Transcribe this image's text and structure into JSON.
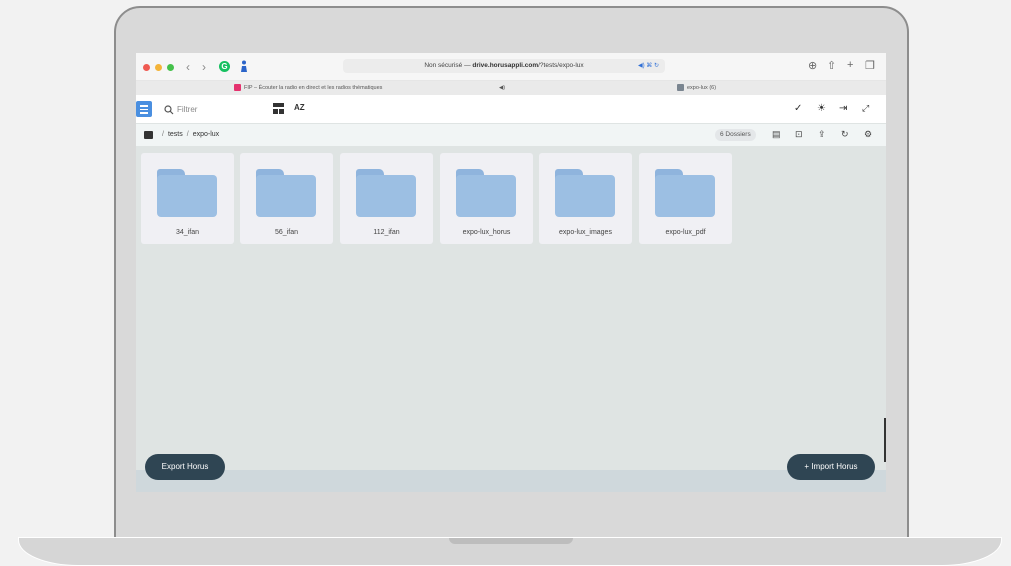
{
  "browser": {
    "url_prefix": "Non sécurisé — ",
    "url_domain": "drive.horusappli.com",
    "url_path": "/?tests/expo-lux",
    "url_extra": "◀) ⌘ ↻",
    "tabs": [
      {
        "title": "FIP – Écouter la radio en direct et les radios thématiques",
        "audio": "◀)"
      },
      {
        "title": "expo-lux (6)"
      }
    ]
  },
  "appbar": {
    "search_placeholder": "Filtrer",
    "sort_label": "AZ"
  },
  "breadcrumb": {
    "items": [
      "tests",
      "expo-lux"
    ],
    "separator": "/",
    "count_badge": "6 Dossiers"
  },
  "folders": [
    {
      "name": "34_ifan"
    },
    {
      "name": "56_ifan"
    },
    {
      "name": "112_ifan"
    },
    {
      "name": "expo-lux_horus"
    },
    {
      "name": "expo-lux_images"
    },
    {
      "name": "expo-lux_pdf"
    }
  ],
  "actions": {
    "export_label": "Export Horus",
    "import_label": "+ Import Horus"
  },
  "colors": {
    "accent": "#4a8fe0",
    "folder": "#9cbfe3",
    "button_dark": "#2f4553"
  }
}
